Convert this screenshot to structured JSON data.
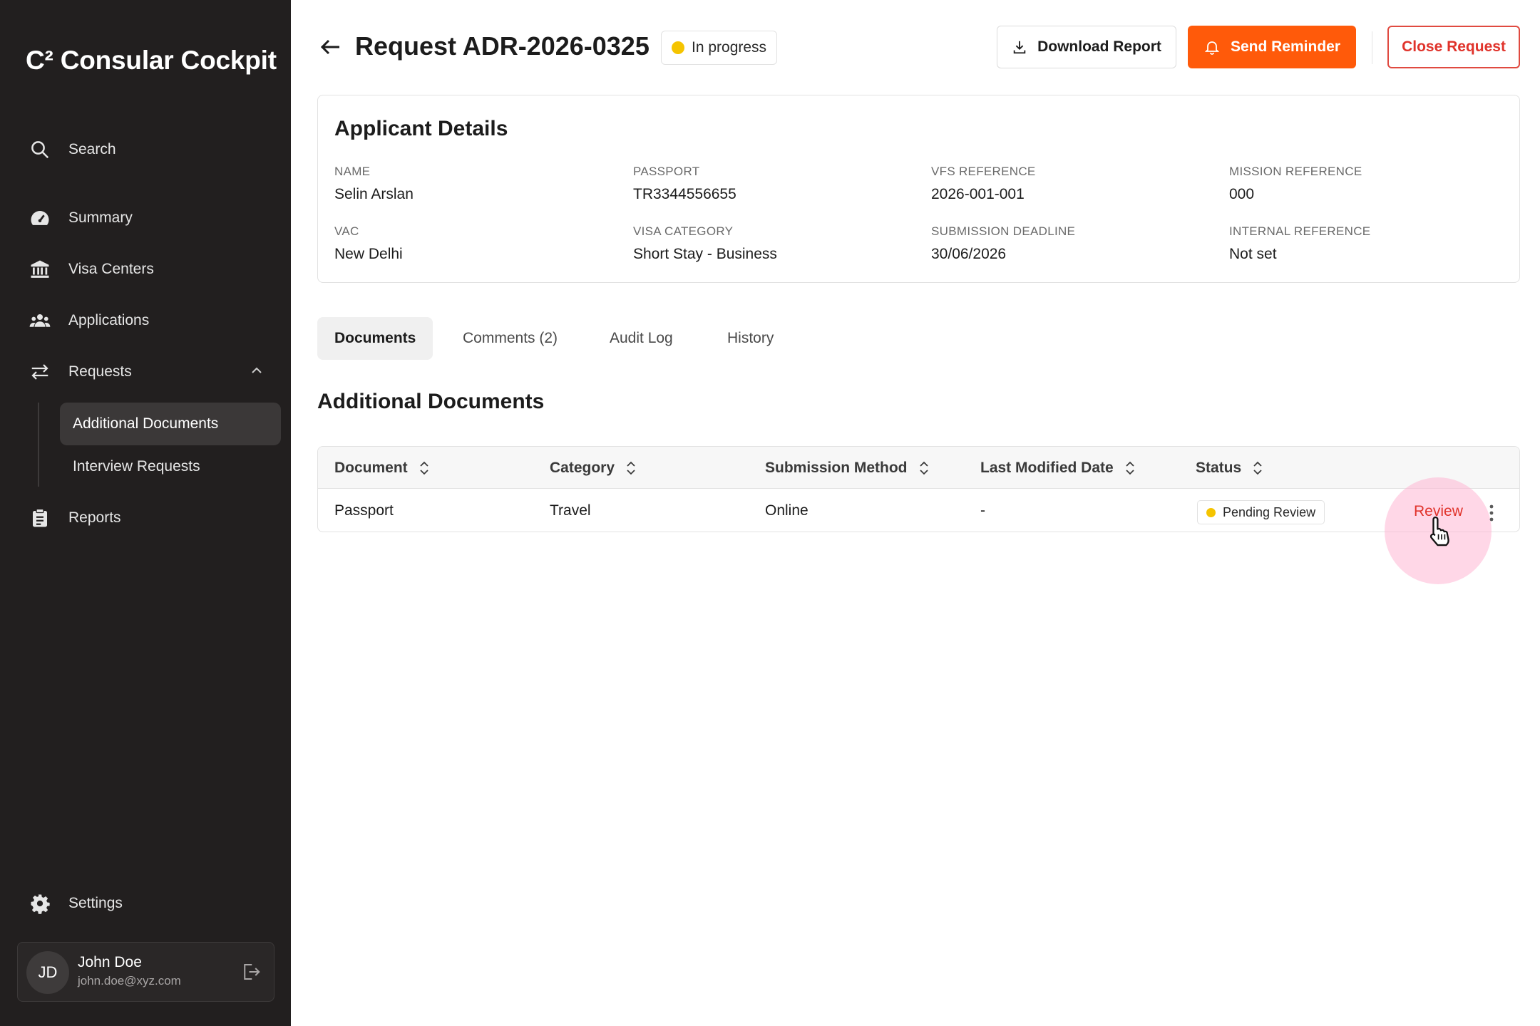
{
  "app": {
    "brand": "C² Consular Cockpit"
  },
  "sidebar": {
    "items": [
      {
        "label": "Search",
        "icon": "search-icon"
      },
      {
        "label": "Summary",
        "icon": "gauge-icon"
      },
      {
        "label": "Visa Centers",
        "icon": "bank-icon"
      },
      {
        "label": "Applications",
        "icon": "people-icon"
      },
      {
        "label": "Requests",
        "icon": "swap-arrows-icon"
      },
      {
        "label": "Reports",
        "icon": "clipboard-icon"
      },
      {
        "label": "Settings",
        "icon": "gear-icon"
      }
    ],
    "requests_sub": [
      {
        "label": "Additional Documents",
        "active": true
      },
      {
        "label": "Interview Requests",
        "active": false
      }
    ],
    "user": {
      "initials": "JD",
      "name": "John Doe",
      "email": "john.doe@xyz.com"
    }
  },
  "header": {
    "title": "Request ADR-2026-0325",
    "status": "In progress",
    "download_label": "Download Report",
    "reminder_label": "Send Reminder",
    "close_label": "Close Request"
  },
  "applicant": {
    "title": "Applicant Details",
    "fields": [
      {
        "label": "NAME",
        "value": "Selin Arslan"
      },
      {
        "label": "PASSPORT",
        "value": "TR3344556655"
      },
      {
        "label": "VFS REFERENCE",
        "value": "2026-001-001"
      },
      {
        "label": "MISSION REFERENCE",
        "value": "000"
      },
      {
        "label": "VAC",
        "value": "New Delhi"
      },
      {
        "label": "VISA CATEGORY",
        "value": "Short Stay - Business"
      },
      {
        "label": "SUBMISSION DEADLINE",
        "value": "30/06/2026"
      },
      {
        "label": "INTERNAL REFERENCE",
        "value": "Not set"
      }
    ]
  },
  "tabs": [
    {
      "label": "Documents",
      "active": true
    },
    {
      "label": "Comments (2)",
      "active": false
    },
    {
      "label": "Audit Log",
      "active": false
    },
    {
      "label": "History",
      "active": false
    }
  ],
  "documents": {
    "title": "Additional Documents",
    "columns": [
      "Document",
      "Category",
      "Submission Method",
      "Last Modified Date",
      "Status"
    ],
    "rows": [
      {
        "document": "Passport",
        "category": "Travel",
        "method": "Online",
        "modified": "-",
        "status": "Pending Review",
        "action": "Review"
      }
    ]
  },
  "colors": {
    "sidebar_bg": "#221f1f",
    "accent": "#ff5a0a",
    "danger": "#e0332b",
    "status_yellow": "#f5c400"
  }
}
